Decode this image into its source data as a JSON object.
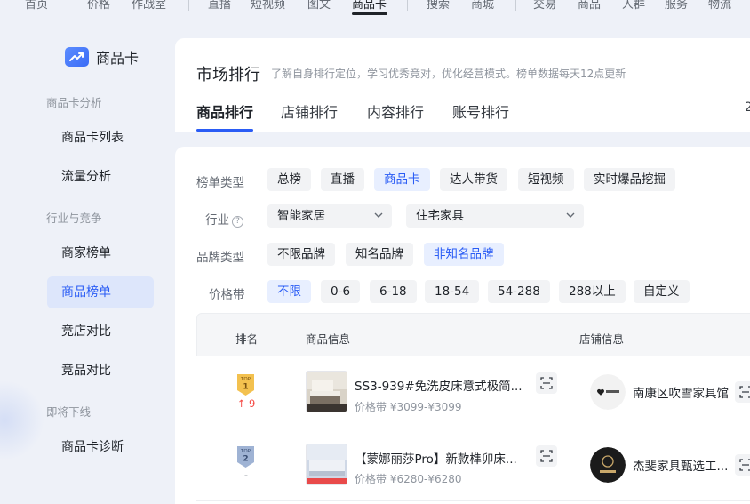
{
  "topnav": {
    "items": [
      "首页",
      "价格",
      "作战室",
      "直播",
      "短视频",
      "图文",
      "商品卡",
      "搜索",
      "商城",
      "交易",
      "商品",
      "人群",
      "服务",
      "物流"
    ],
    "active": "商品卡"
  },
  "sidebar": {
    "brand": "商品卡",
    "groups": [
      {
        "title": "商品卡分析",
        "items": [
          "商品卡列表",
          "流量分析"
        ]
      },
      {
        "title": "行业与竞争",
        "items": [
          "商家榜单",
          "商品榜单",
          "竞店对比",
          "竞品对比"
        ]
      },
      {
        "title": "即将下线",
        "items": [
          "商品卡诊断"
        ]
      }
    ],
    "active_item": "商品榜单"
  },
  "header": {
    "title": "市场排行",
    "description": "了解自身排行定位，学习优秀竞对，优化经营模式。榜单数据每天12点更新",
    "tabs": [
      "商品排行",
      "店铺排行",
      "内容排行",
      "账号排行"
    ],
    "active_tab": "商品排行",
    "cut_text": "2"
  },
  "filters": {
    "list_type": {
      "label": "榜单类型",
      "options": [
        "总榜",
        "直播",
        "商品卡",
        "达人带货",
        "短视频",
        "实时爆品挖掘"
      ],
      "selected": "商品卡"
    },
    "industry": {
      "label": "行业",
      "primary": "智能家居",
      "secondary": "住宅家具"
    },
    "brand_type": {
      "label": "品牌类型",
      "options": [
        "不限品牌",
        "知名品牌",
        "非知名品牌"
      ],
      "selected": "非知名品牌"
    },
    "price_band": {
      "label": "价格带",
      "options": [
        "不限",
        "0-6",
        "6-18",
        "18-54",
        "54-288",
        "288以上",
        "自定义"
      ],
      "selected": "不限"
    }
  },
  "table": {
    "headers": [
      "排名",
      "商品信息",
      "店铺信息"
    ],
    "rows": [
      {
        "rank": "1",
        "badge_top": "TOP",
        "badge_color": "#f3b84a",
        "change": "↑ 9",
        "change_type": "up",
        "title": "SS3-939#免洗皮床意式极简...",
        "price": "价格带 ¥3099-¥3099",
        "shop": "南康区吹雪家具馆"
      },
      {
        "rank": "2",
        "badge_top": "TOP",
        "badge_color": "#8aa3c8",
        "change": "-",
        "change_type": "flat",
        "title": "【蒙娜丽莎Pro】新款榫卯床...",
        "price": "价格带 ¥6280-¥6280",
        "shop": "杰斐家具甄选工..."
      }
    ]
  },
  "colors": {
    "accent": "#2a5cf5",
    "accent_bg": "#e8efff",
    "up": "#f54a45"
  }
}
